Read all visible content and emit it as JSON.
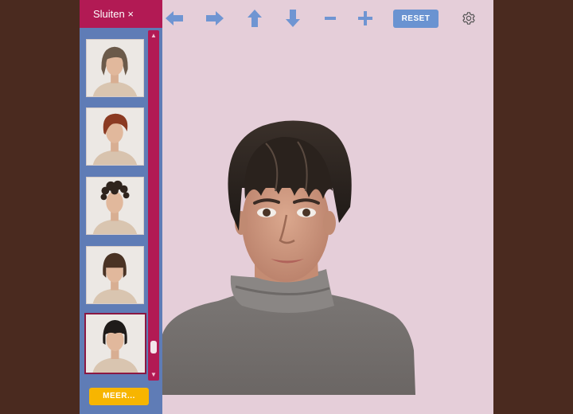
{
  "sidebar": {
    "close_label": "Sluiten ×",
    "more_label": "MEER..."
  },
  "toolbar": {
    "reset_label": "RESET",
    "icons": [
      "arrow-left-icon",
      "arrow-right-icon",
      "arrow-up-icon",
      "arrow-down-icon",
      "minus-icon",
      "plus-icon",
      "gear-icon"
    ]
  },
  "colors": {
    "accent": "#b21a54",
    "sidebar": "#5f7cb6",
    "background": "#e5ced9",
    "button": "#6a93d1",
    "more": "#f7b500",
    "icons": "#6f95d2"
  }
}
